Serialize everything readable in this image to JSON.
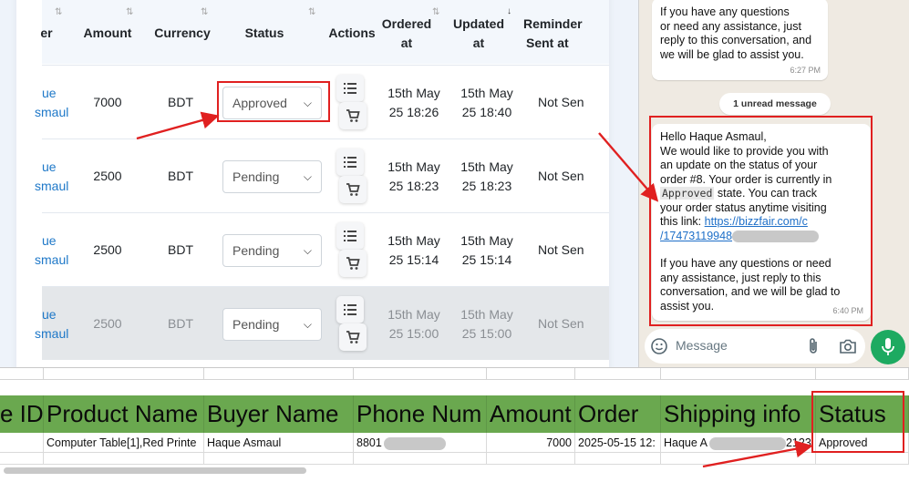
{
  "orders_table": {
    "columns": {
      "buyer": "er",
      "amount": "Amount",
      "currency": "Currency",
      "status": "Status",
      "actions": "Actions",
      "ordered_at_1": "Ordered",
      "ordered_at_2": "at",
      "updated_at_1": "Updated",
      "updated_at_2": "at",
      "reminder_1": "Reminder",
      "reminder_2": "Sent at"
    },
    "rows": [
      {
        "buyer_1": "ue",
        "buyer_2": "smaul",
        "amount": "7000",
        "currency": "BDT",
        "status": "Approved",
        "ordered_1": "15th May",
        "ordered_2": "25 18:26",
        "updated_1": "15th May",
        "updated_2": "25 18:40",
        "reminder": "Not Sen"
      },
      {
        "buyer_1": "ue",
        "buyer_2": "smaul",
        "amount": "2500",
        "currency": "BDT",
        "status": "Pending",
        "ordered_1": "15th May",
        "ordered_2": "25 18:23",
        "updated_1": "15th May",
        "updated_2": "25 18:23",
        "reminder": "Not Sen"
      },
      {
        "buyer_1": "ue",
        "buyer_2": "smaul",
        "amount": "2500",
        "currency": "BDT",
        "status": "Pending",
        "ordered_1": "15th May",
        "ordered_2": "25 15:14",
        "updated_1": "15th May",
        "updated_2": "25 15:14",
        "reminder": "Not Sen"
      },
      {
        "buyer_1": "ue",
        "buyer_2": "smaul",
        "amount": "2500",
        "currency": "BDT",
        "status": "Pending",
        "ordered_1": "15th May",
        "ordered_2": "25 15:00",
        "updated_1": "15th May",
        "updated_2": "25 15:00",
        "reminder": "Not Sen"
      }
    ]
  },
  "chat": {
    "prev_message": {
      "lines": [
        "If you have any questions",
        "or need any assistance, just",
        "reply to this conversation, and",
        "we will be glad to assist you."
      ],
      "time": "6:27 PM"
    },
    "unread_label": "1 unread message",
    "message": {
      "greeting": "Hello Haque Asmaul,",
      "line1": "We would like to provide you with",
      "line2": "an update on the status of your",
      "line3": "order #8. Your order is currently in",
      "status_code": "Approved",
      "line4_rest": " state. You can track",
      "line5": "your order status anytime visiting",
      "line6_prefix": "this link: ",
      "link_1": "https://bizzfair.com/c",
      "link_2": "/17473119948",
      "para2_1": "If you have any questions or need",
      "para2_2": "any assistance, just reply to this",
      "para2_3": "conversation, and we will be glad to",
      "para2_4": "assist you.",
      "time": "6:40 PM"
    },
    "input_placeholder": "Message"
  },
  "sheet": {
    "headers": [
      "e ID",
      "Product Name",
      "Buyer Name",
      "Phone Num",
      "Amount",
      "Order",
      "Shipping info",
      "Status"
    ],
    "row": {
      "product": "Computer Table[1],Red Printe",
      "buyer": "Haque Asmaul",
      "phone": "8801",
      "amount": "7000",
      "order": "2025-05-15 12:",
      "shipping_start": "Haque A",
      "shipping_end": "2123",
      "status": "Approved"
    }
  },
  "colors": {
    "sheet_header_green": "#6aa84f",
    "highlight_red": "#e02020",
    "link_blue": "#1e78c8",
    "whatsapp_green": "#1daa61"
  }
}
